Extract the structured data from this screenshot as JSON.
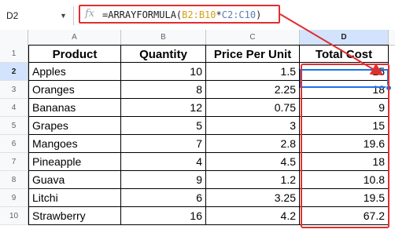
{
  "name_box": {
    "value": "D2"
  },
  "formula_bar": {
    "fx_label": "fx",
    "prefix": "=ARRAYFORMULA(",
    "range1": "B2:B10",
    "op": "*",
    "range2": "C2:C10",
    "suffix": ")"
  },
  "columns": [
    "A",
    "B",
    "C",
    "D"
  ],
  "rows": [
    "1",
    "2",
    "3",
    "4",
    "5",
    "6",
    "7",
    "8",
    "9",
    "10"
  ],
  "headers": [
    "Product",
    "Quantity",
    "Price Per Unit",
    "Total Cost"
  ],
  "data": [
    [
      "Apples",
      "10",
      "1.5",
      "15"
    ],
    [
      "Oranges",
      "8",
      "2.25",
      "18"
    ],
    [
      "Bananas",
      "12",
      "0.75",
      "9"
    ],
    [
      "Grapes",
      "5",
      "3",
      "15"
    ],
    [
      "Mangoes",
      "7",
      "2.8",
      "19.6"
    ],
    [
      "Pineapple",
      "4",
      "4.5",
      "18"
    ],
    [
      "Guava",
      "9",
      "1.2",
      "10.8"
    ],
    [
      "Litchi",
      "6",
      "3.25",
      "19.5"
    ],
    [
      "Strawberry",
      "16",
      "4.2",
      "67.2"
    ]
  ],
  "selected_cell": "D2",
  "annotation_color": "#e02f2f"
}
